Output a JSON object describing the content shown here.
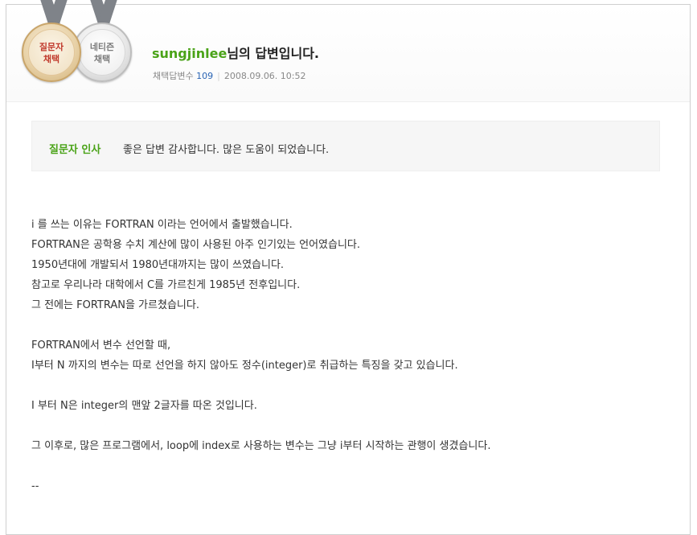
{
  "badges": {
    "questioner": {
      "line1": "질문자",
      "line2": "채택"
    },
    "netizen": {
      "line1": "네티즌",
      "line2": "채택"
    }
  },
  "answer": {
    "username": "sungjinlee",
    "title_suffix": "님의 답변입니다.",
    "adopted_label": "채택답변수",
    "adopted_count": "109",
    "date": "2008.09.06. 10:52"
  },
  "greeting": {
    "label": "질문자 인사",
    "text": "좋은 답변 감사합니다. 많은 도움이 되었습니다."
  },
  "body": {
    "p1": [
      "i 를 쓰는 이유는 FORTRAN 이라는 언어에서 출발했습니다.",
      "FORTRAN은 공학용 수치 계산에 많이 사용된 아주 인기있는 언어였습니다.",
      "1950년대에 개발되서 1980년대까지는 많이 쓰였습니다.",
      "참고로 우리나라 대학에서 C를 가르친게 1985년 전후입니다.",
      "그 전에는 FORTRAN을 가르쳤습니다."
    ],
    "p2": [
      "FORTRAN에서 변수 선언할 때,",
      "I부터 N 까지의 변수는 따로 선언을 하지 않아도 정수(integer)로 취급하는 특징을 갖고 있습니다."
    ],
    "p3": [
      "I 부터 N은 integer의 맨앞 2글자를 따온 것입니다."
    ],
    "p4": [
      "그 이후로, 많은 프로그램에서, loop에 index로 사용하는 변수는 그냥 i부터 시작하는 관행이 생겼습니다."
    ],
    "p5": [
      "--"
    ]
  }
}
